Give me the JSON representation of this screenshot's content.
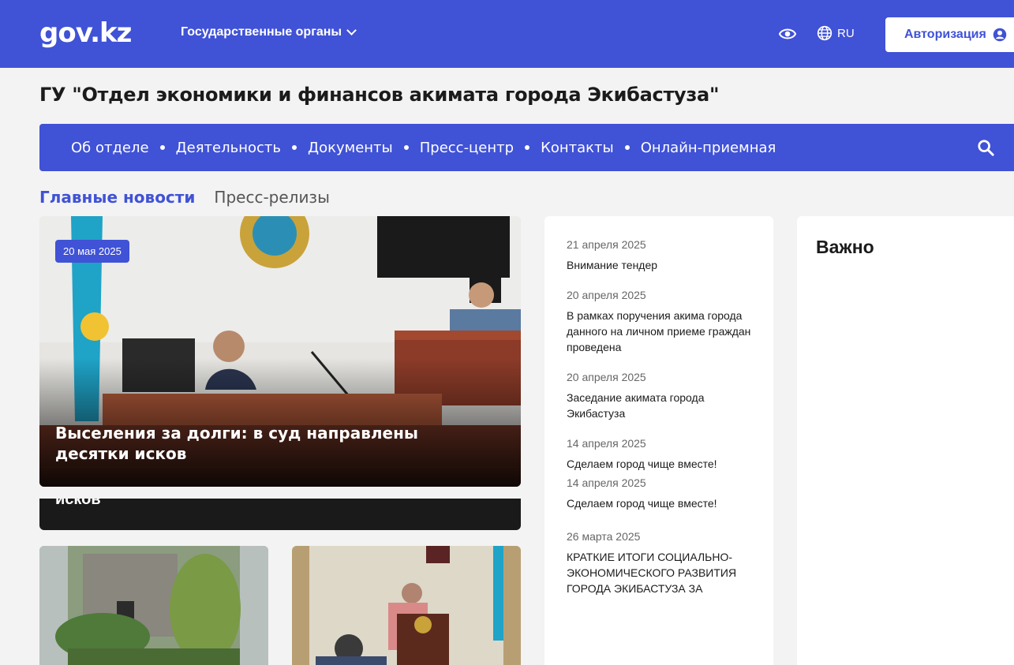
{
  "header": {
    "logo": "gov.kz",
    "gov_menu_label": "Государственные органы",
    "lang_label": "RU",
    "auth_label": "Авторизация"
  },
  "org_title": "ГУ \"Отдел экономики и финансов акимата города Экибастуза\"",
  "nav": {
    "items": [
      "Об отделе",
      "Деятельность",
      "Документы",
      "Пресс-центр",
      "Контакты",
      "Онлайн-приемная"
    ]
  },
  "tabs": [
    "Главные новости",
    "Пресс-релизы"
  ],
  "hero": {
    "date": "20 мая 2025",
    "title": "Выселения за долги: в суд направлены десятки исков",
    "ghost_text": "исков"
  },
  "news": [
    {
      "date": "21 апреля 2025",
      "text": "Внимание тендер"
    },
    {
      "date": "20 апреля 2025",
      "text": "В рамках поручения акима города данного на личном приеме граждан проведена"
    },
    {
      "date": "20 апреля 2025",
      "text": "Заседание акимата города Экибастуза"
    },
    {
      "date": "14 апреля 2025",
      "text": "Сделаем город чище вместе!"
    },
    {
      "date": "14 апреля 2025",
      "text": "Сделаем город чище вместе!"
    },
    {
      "date": "26 марта 2025",
      "text": "КРАТКИЕ ИТОГИ СОЦИАЛЬНО-ЭКОНОМИЧЕСКОГО РАЗВИТИЯ ГОРОДА ЭКИБАСТУЗА ЗА"
    }
  ],
  "important_title": "Важно",
  "colors": {
    "brand": "#4052d6",
    "background": "#f3f3f3"
  },
  "icons": [
    "eye-icon",
    "globe-icon",
    "user-icon",
    "search-icon",
    "chevron-down-icon"
  ]
}
